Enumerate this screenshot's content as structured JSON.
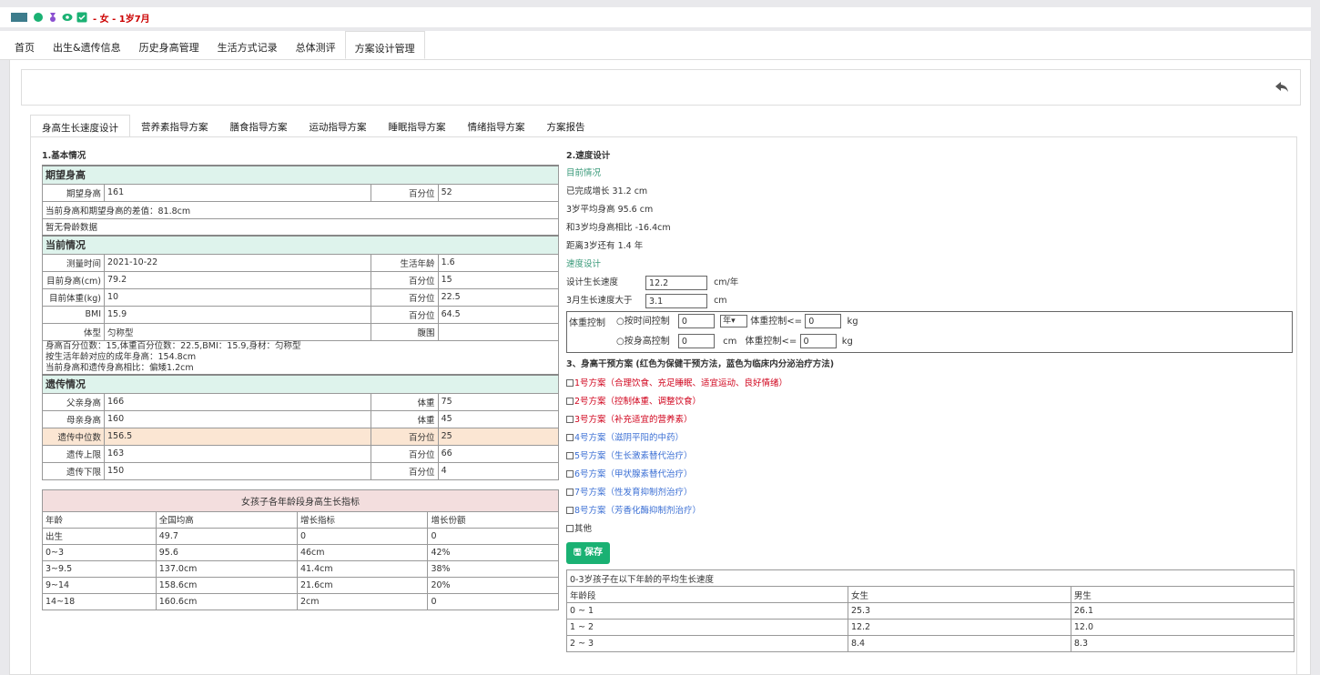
{
  "header": {
    "title": "- 女 - 1岁7月"
  },
  "nav": {
    "tabs": [
      "首页",
      "出生&遗传信息",
      "历史身高管理",
      "生活方式记录",
      "总体测评",
      "方案设计管理"
    ],
    "active": 5
  },
  "subtabs": {
    "items": [
      "身高生长速度设计",
      "营养素指导方案",
      "膳食指导方案",
      "运动指导方案",
      "睡眠指导方案",
      "情绪指导方案",
      "方案报告"
    ],
    "active": 0
  },
  "basic": {
    "heading": "1.基本情况",
    "expected": {
      "title": "期望身高",
      "height_label": "期望身高",
      "height": "161",
      "pct_label": "百分位",
      "pct": "52",
      "diff": "当前身高和期望身高的差值：81.8cm",
      "bone": "暂无骨龄数据"
    },
    "current": {
      "title": "当前情况",
      "rows": [
        {
          "l1": "测量时间",
          "v1": "2021-10-22",
          "l2": "生活年龄",
          "v2": "1.6"
        },
        {
          "l1": "目前身高(cm)",
          "v1": "79.2",
          "l2": "百分位",
          "v2": "15"
        },
        {
          "l1": "目前体重(kg)",
          "v1": "10",
          "l2": "百分位",
          "v2": "22.5"
        },
        {
          "l1": "BMI",
          "v1": "15.9",
          "l2": "百分位",
          "v2": "64.5"
        },
        {
          "l1": "体型",
          "v1": "匀称型",
          "l2": "腹围",
          "v2": ""
        }
      ],
      "notes": [
        "身高百分位数：15,体重百分位数：22.5,BMI：15.9,身材：匀称型",
        "按生活年龄对应的成年身高：154.8cm",
        "当前身高和遗传身高相比：偏矮1.2cm"
      ]
    },
    "genetic": {
      "title": "遗传情况",
      "rows": [
        {
          "l1": "父亲身高",
          "v1": "166",
          "l2": "体重",
          "v2": "75"
        },
        {
          "l1": "母亲身高",
          "v1": "160",
          "l2": "体重",
          "v2": "45"
        },
        {
          "l1": "遗传中位数",
          "v1": "156.5",
          "l2": "百分位",
          "v2": "25"
        },
        {
          "l1": "遗传上限",
          "v1": "163",
          "l2": "百分位",
          "v2": "66"
        },
        {
          "l1": "遗传下限",
          "v1": "150",
          "l2": "百分位",
          "v2": "4"
        }
      ]
    }
  },
  "growth_table": {
    "title": "女孩子各年龄段身高生长指标",
    "headers": [
      "年龄",
      "全国均高",
      "增长指标",
      "增长份额"
    ],
    "rows": [
      [
        "出生",
        "49.7",
        "0",
        "0"
      ],
      [
        "0~3",
        "95.6",
        "46cm",
        "42%"
      ],
      [
        "3~9.5",
        "137.0cm",
        "41.4cm",
        "38%"
      ],
      [
        "9~14",
        "158.6cm",
        "21.6cm",
        "20%"
      ],
      [
        "14~18",
        "160.6cm",
        "2cm",
        "0"
      ]
    ]
  },
  "speed": {
    "heading": "2.速度设计",
    "current_label": "目前情况",
    "lines": [
      "已完成增长  31.2 cm",
      "3岁平均身高  95.6 cm",
      "和3岁均身高相比  -16.4cm",
      "距离3岁还有  1.4 年"
    ],
    "design_label": "速度设计",
    "speed_label": "设计生长速度",
    "speed_value": "12.2",
    "speed_unit": "cm/年",
    "m3_label": "3月生长速度大于",
    "m3_value": "3.1",
    "m3_unit": "cm",
    "weight": {
      "label": "体重控制",
      "opt1": "○按时间控制",
      "opt1_val": "0",
      "opt1_unit": "年",
      "opt1_ctrl": "体重控制<=",
      "opt1_ctrl_val": "0",
      "kg": "kg",
      "opt2": "○按身高控制",
      "opt2_val": "0",
      "opt2_unit": "cm",
      "opt2_ctrl": "体重控制<=",
      "opt2_ctrl_val": "0"
    }
  },
  "plans": {
    "heading": "3、身高干预方案 (红色为保健干预方法，蓝色为临床内分泌治疗方法)",
    "items": [
      {
        "text": "1号方案（合理饮食、充足睡眠、适宜运动、良好情绪）",
        "color": "red"
      },
      {
        "text": "2号方案（控制体重、调整饮食）",
        "color": "red"
      },
      {
        "text": "3号方案（补充适宜的营养素）",
        "color": "red"
      },
      {
        "text": "4号方案（滋阴平阳的中药）",
        "color": "blue"
      },
      {
        "text": "5号方案（生长激素替代治疗）",
        "color": "blue"
      },
      {
        "text": "6号方案（甲状腺素替代治疗）",
        "color": "blue"
      },
      {
        "text": "7号方案（性发育抑制剂治疗）",
        "color": "blue"
      },
      {
        "text": "8号方案（芳香化酶抑制剂治疗）",
        "color": "blue"
      },
      {
        "text": "其他",
        "color": "plain"
      }
    ],
    "save": "保存"
  },
  "avg_table": {
    "title": "0-3岁孩子在以下年龄的平均生长速度",
    "headers": [
      "年龄段",
      "女生",
      "男生"
    ],
    "rows": [
      [
        "0 ~ 1",
        "25.3",
        "26.1"
      ],
      [
        "1 ~ 2",
        "12.2",
        "12.0"
      ],
      [
        "2 ~ 3",
        "8.4",
        "8.3"
      ]
    ]
  }
}
